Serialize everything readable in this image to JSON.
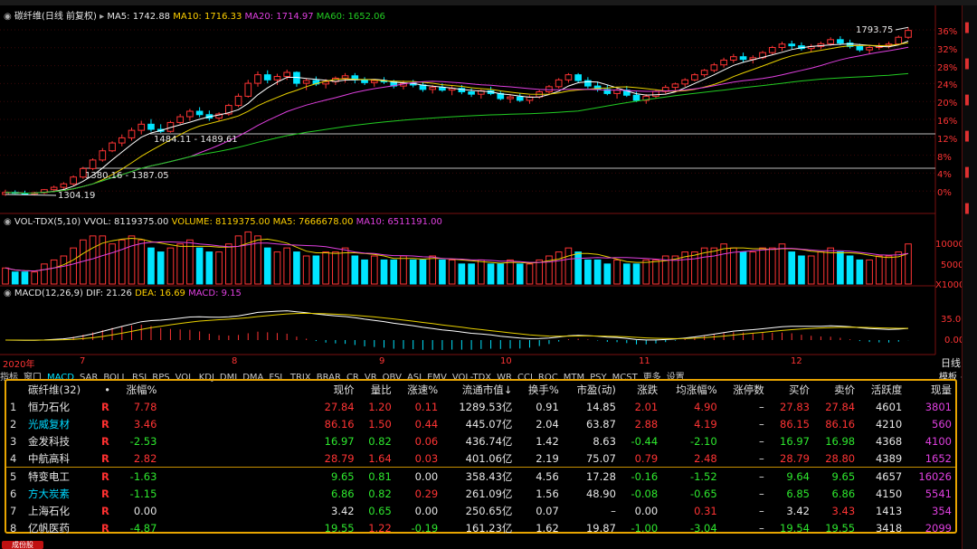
{
  "price_legend": {
    "title": "碳纤维(日线 前复权)",
    "ma5": "MA5: 1742.88",
    "ma10": "MA10: 1716.33",
    "ma20": "MA20: 1714.97",
    "ma60": "MA60: 1652.06"
  },
  "price_annotations": {
    "high": "1793.75",
    "mid1": "1484.11 - 1489.61",
    "mid2": "1380.16 - 1387.05",
    "low": "1304.19"
  },
  "pct_ticks": [
    "36%",
    "32%",
    "28%",
    "24%",
    "20%",
    "16%",
    "12%",
    "8%",
    "4%",
    "0%"
  ],
  "volume_legend": {
    "title": "VOL-TDX(5,10)",
    "vvol": "VVOL: 8119375.00",
    "volume": "VOLUME: 8119375.00",
    "ma5": "MA5: 7666678.00",
    "ma10": "MA10: 6511191.00"
  },
  "volume_ticks": [
    "10000",
    "5000",
    "X1000"
  ],
  "macd_legend": {
    "title": "MACD(12,26,9)",
    "dif": "DIF: 21.26",
    "dea": "DEA: 16.69",
    "macd": "MACD: 9.15"
  },
  "macd_ticks": [
    "35.00",
    "0.00"
  ],
  "date_labels": [
    "2020年",
    "7",
    "8",
    "9",
    "10",
    "11",
    "12"
  ],
  "date_right": "日线",
  "indicator_tabs": [
    "指标",
    "窗口",
    "MACD",
    "SAR",
    "BOLL",
    "RSI",
    "RPS",
    "VOL",
    "KDJ",
    "DMI",
    "DMA",
    "FSL",
    "TRIX",
    "BRAR",
    "CR",
    "VR",
    "OBV",
    "ASI",
    "EMV",
    "VOL-TDX",
    "WR",
    "CCI",
    "ROC",
    "MTM",
    "PSY",
    "MCST",
    "更多",
    "设置"
  ],
  "tabs_right": "模板",
  "table": {
    "headers": [
      "碳纤维(32)",
      "•",
      "涨幅%",
      "现价",
      "量比",
      "涨速%",
      "流通市值↓",
      "换手%",
      "市盈(动)",
      "涨跌",
      "均涨幅%",
      "涨停数",
      "买价",
      "卖价",
      "活跃度",
      "现量"
    ],
    "rows": [
      {
        "idx": "1",
        "name": "恒力石化",
        "flag": "R",
        "chg": "7.78",
        "price": "27.84",
        "vr": "1.20",
        "speed": "0.11",
        "mcap": "1289.53亿",
        "turn": "0.91",
        "pe": "14.85",
        "diff": "2.01",
        "avg": "4.90",
        "limit": "–",
        "bid": "27.83",
        "ask": "27.84",
        "act": "4601",
        "vol": "3801"
      },
      {
        "idx": "2",
        "name": "光威复材",
        "flag": "R",
        "chg": "3.46",
        "price": "86.16",
        "vr": "1.50",
        "speed": "0.44",
        "mcap": "445.07亿",
        "turn": "2.04",
        "pe": "63.87",
        "diff": "2.88",
        "avg": "4.19",
        "limit": "–",
        "bid": "86.15",
        "ask": "86.16",
        "act": "4210",
        "vol": "560"
      },
      {
        "idx": "3",
        "name": "金发科技",
        "flag": "R",
        "chg": "-2.53",
        "price": "16.97",
        "vr": "0.82",
        "speed": "0.06",
        "mcap": "436.74亿",
        "turn": "1.42",
        "pe": "8.63",
        "diff": "-0.44",
        "avg": "-2.10",
        "limit": "–",
        "bid": "16.97",
        "ask": "16.98",
        "act": "4368",
        "vol": "4100"
      },
      {
        "idx": "4",
        "name": "中航高科",
        "flag": "R",
        "chg": "2.82",
        "price": "28.79",
        "vr": "1.64",
        "speed": "0.03",
        "mcap": "401.06亿",
        "turn": "2.19",
        "pe": "75.07",
        "diff": "0.79",
        "avg": "2.48",
        "limit": "–",
        "bid": "28.79",
        "ask": "28.80",
        "act": "4389",
        "vol": "1652"
      },
      {
        "idx": "5",
        "name": "特变电工",
        "flag": "R",
        "chg": "-1.63",
        "price": "9.65",
        "vr": "0.81",
        "speed": "0.00",
        "mcap": "358.43亿",
        "turn": "4.56",
        "pe": "17.28",
        "diff": "-0.16",
        "avg": "-1.52",
        "limit": "–",
        "bid": "9.64",
        "ask": "9.65",
        "act": "4657",
        "vol": "16026"
      },
      {
        "idx": "6",
        "name": "方大炭素",
        "flag": "R",
        "chg": "-1.15",
        "price": "6.86",
        "vr": "0.82",
        "speed": "0.29",
        "mcap": "261.09亿",
        "turn": "1.56",
        "pe": "48.90",
        "diff": "-0.08",
        "avg": "-0.65",
        "limit": "–",
        "bid": "6.85",
        "ask": "6.86",
        "act": "4150",
        "vol": "5541"
      },
      {
        "idx": "7",
        "name": "上海石化",
        "flag": "R",
        "chg": "0.00",
        "price": "3.42",
        "vr": "0.65",
        "speed": "0.00",
        "mcap": "250.65亿",
        "turn": "0.07",
        "pe": "–",
        "diff": "0.00",
        "avg": "0.31",
        "limit": "–",
        "bid": "3.42",
        "ask": "3.43",
        "act": "1413",
        "vol": "354"
      },
      {
        "idx": "8",
        "name": "亿帆医药",
        "flag": "R",
        "chg": "-4.87",
        "price": "19.55",
        "vr": "1.22",
        "speed": "-0.19",
        "mcap": "161.23亿",
        "turn": "1.62",
        "pe": "19.87",
        "diff": "-1.00",
        "avg": "-3.04",
        "limit": "–",
        "bid": "19.54",
        "ask": "19.55",
        "act": "3418",
        "vol": "2099"
      }
    ]
  },
  "bottom_label": "成份股",
  "colors": {
    "up": "#ff3434",
    "down": "#00e5ff",
    "ma5": "#ffffff",
    "ma10": "#e8d000",
    "ma20": "#e040e0",
    "ma60": "#22cc22",
    "border": "#e8a400"
  },
  "candle_data": [
    [
      1304,
      1318,
      1300,
      1310
    ],
    [
      1310,
      1316,
      1305,
      1308
    ],
    [
      1308,
      1315,
      1302,
      1306
    ],
    [
      1306,
      1312,
      1301,
      1309
    ],
    [
      1309,
      1320,
      1305,
      1318
    ],
    [
      1318,
      1330,
      1312,
      1325
    ],
    [
      1325,
      1340,
      1320,
      1335
    ],
    [
      1335,
      1360,
      1330,
      1355
    ],
    [
      1355,
      1385,
      1350,
      1380
    ],
    [
      1380,
      1410,
      1375,
      1405
    ],
    [
      1405,
      1440,
      1400,
      1432
    ],
    [
      1432,
      1460,
      1428,
      1455
    ],
    [
      1455,
      1480,
      1445,
      1470
    ],
    [
      1470,
      1500,
      1462,
      1492
    ],
    [
      1492,
      1520,
      1480,
      1510
    ],
    [
      1510,
      1525,
      1488,
      1495
    ],
    [
      1495,
      1510,
      1484,
      1489
    ],
    [
      1489,
      1520,
      1485,
      1515
    ],
    [
      1515,
      1540,
      1510,
      1532
    ],
    [
      1532,
      1555,
      1520,
      1548
    ],
    [
      1548,
      1560,
      1530,
      1538
    ],
    [
      1538,
      1550,
      1520,
      1528
    ],
    [
      1528,
      1545,
      1520,
      1540
    ],
    [
      1540,
      1570,
      1535,
      1565
    ],
    [
      1565,
      1600,
      1560,
      1592
    ],
    [
      1592,
      1640,
      1588,
      1630
    ],
    [
      1630,
      1665,
      1620,
      1655
    ],
    [
      1655,
      1668,
      1630,
      1640
    ],
    [
      1640,
      1658,
      1625,
      1650
    ],
    [
      1650,
      1670,
      1640,
      1662
    ],
    [
      1662,
      1665,
      1620,
      1630
    ],
    [
      1630,
      1645,
      1610,
      1638
    ],
    [
      1638,
      1650,
      1622,
      1628
    ],
    [
      1628,
      1642,
      1615,
      1635
    ],
    [
      1635,
      1650,
      1625,
      1645
    ],
    [
      1645,
      1660,
      1632,
      1652
    ],
    [
      1652,
      1660,
      1630,
      1640
    ],
    [
      1640,
      1648,
      1625,
      1632
    ],
    [
      1632,
      1642,
      1620,
      1638
    ],
    [
      1638,
      1648,
      1628,
      1634
    ],
    [
      1634,
      1640,
      1615,
      1622
    ],
    [
      1622,
      1638,
      1612,
      1630
    ],
    [
      1630,
      1640,
      1618,
      1625
    ],
    [
      1625,
      1632,
      1605,
      1612
    ],
    [
      1612,
      1625,
      1600,
      1618
    ],
    [
      1618,
      1630,
      1605,
      1610
    ],
    [
      1610,
      1622,
      1595,
      1615
    ],
    [
      1615,
      1625,
      1598,
      1605
    ],
    [
      1605,
      1615,
      1590,
      1598
    ],
    [
      1598,
      1612,
      1585,
      1608
    ],
    [
      1608,
      1620,
      1595,
      1600
    ],
    [
      1600,
      1608,
      1580,
      1585
    ],
    [
      1585,
      1598,
      1572,
      1590
    ],
    [
      1590,
      1600,
      1575,
      1580
    ],
    [
      1580,
      1595,
      1570,
      1590
    ],
    [
      1590,
      1610,
      1585,
      1605
    ],
    [
      1605,
      1625,
      1600,
      1620
    ],
    [
      1620,
      1645,
      1615,
      1640
    ],
    [
      1640,
      1660,
      1632,
      1655
    ],
    [
      1655,
      1660,
      1630,
      1638
    ],
    [
      1638,
      1648,
      1615,
      1622
    ],
    [
      1622,
      1635,
      1605,
      1612
    ],
    [
      1612,
      1625,
      1595,
      1600
    ],
    [
      1600,
      1615,
      1585,
      1610
    ],
    [
      1610,
      1622,
      1590,
      1595
    ],
    [
      1595,
      1605,
      1575,
      1580
    ],
    [
      1580,
      1598,
      1570,
      1592
    ],
    [
      1592,
      1612,
      1586,
      1606
    ],
    [
      1606,
      1625,
      1600,
      1618
    ],
    [
      1618,
      1632,
      1610,
      1628
    ],
    [
      1628,
      1645,
      1620,
      1640
    ],
    [
      1640,
      1660,
      1636,
      1655
    ],
    [
      1655,
      1672,
      1648,
      1668
    ],
    [
      1668,
      1690,
      1662,
      1684
    ],
    [
      1684,
      1705,
      1676,
      1698
    ],
    [
      1698,
      1716,
      1690,
      1708
    ],
    [
      1708,
      1720,
      1692,
      1700
    ],
    [
      1700,
      1712,
      1688,
      1705
    ],
    [
      1705,
      1725,
      1700,
      1720
    ],
    [
      1720,
      1740,
      1715,
      1735
    ],
    [
      1735,
      1752,
      1725,
      1745
    ],
    [
      1745,
      1755,
      1730,
      1740
    ],
    [
      1740,
      1750,
      1726,
      1732
    ],
    [
      1732,
      1745,
      1722,
      1738
    ],
    [
      1738,
      1752,
      1730,
      1746
    ],
    [
      1746,
      1765,
      1740,
      1758
    ],
    [
      1758,
      1768,
      1742,
      1748
    ],
    [
      1748,
      1758,
      1732,
      1738
    ],
    [
      1738,
      1746,
      1722,
      1728
    ],
    [
      1728,
      1740,
      1716,
      1735
    ],
    [
      1735,
      1748,
      1728,
      1740
    ],
    [
      1740,
      1752,
      1732,
      1745
    ],
    [
      1745,
      1770,
      1742,
      1765
    ],
    [
      1765,
      1794,
      1760,
      1785
    ]
  ],
  "volume_data": [
    4,
    3,
    3,
    3,
    5,
    6,
    7,
    9,
    11,
    12,
    12,
    10,
    11,
    12,
    11,
    9,
    8,
    9,
    10,
    11,
    9,
    8,
    8,
    10,
    12,
    13,
    12,
    9,
    8,
    9,
    8,
    7,
    7,
    8,
    8,
    9,
    7,
    6,
    7,
    6,
    6,
    7,
    6,
    6,
    7,
    6,
    6,
    5,
    5,
    6,
    5,
    5,
    6,
    5,
    5,
    6,
    7,
    8,
    9,
    8,
    6,
    6,
    5,
    6,
    5,
    5,
    6,
    6,
    7,
    7,
    8,
    8,
    9,
    9,
    10,
    9,
    8,
    8,
    9,
    9,
    10,
    8,
    7,
    7,
    8,
    9,
    8,
    7,
    6,
    6,
    7,
    7,
    8,
    10
  ]
}
